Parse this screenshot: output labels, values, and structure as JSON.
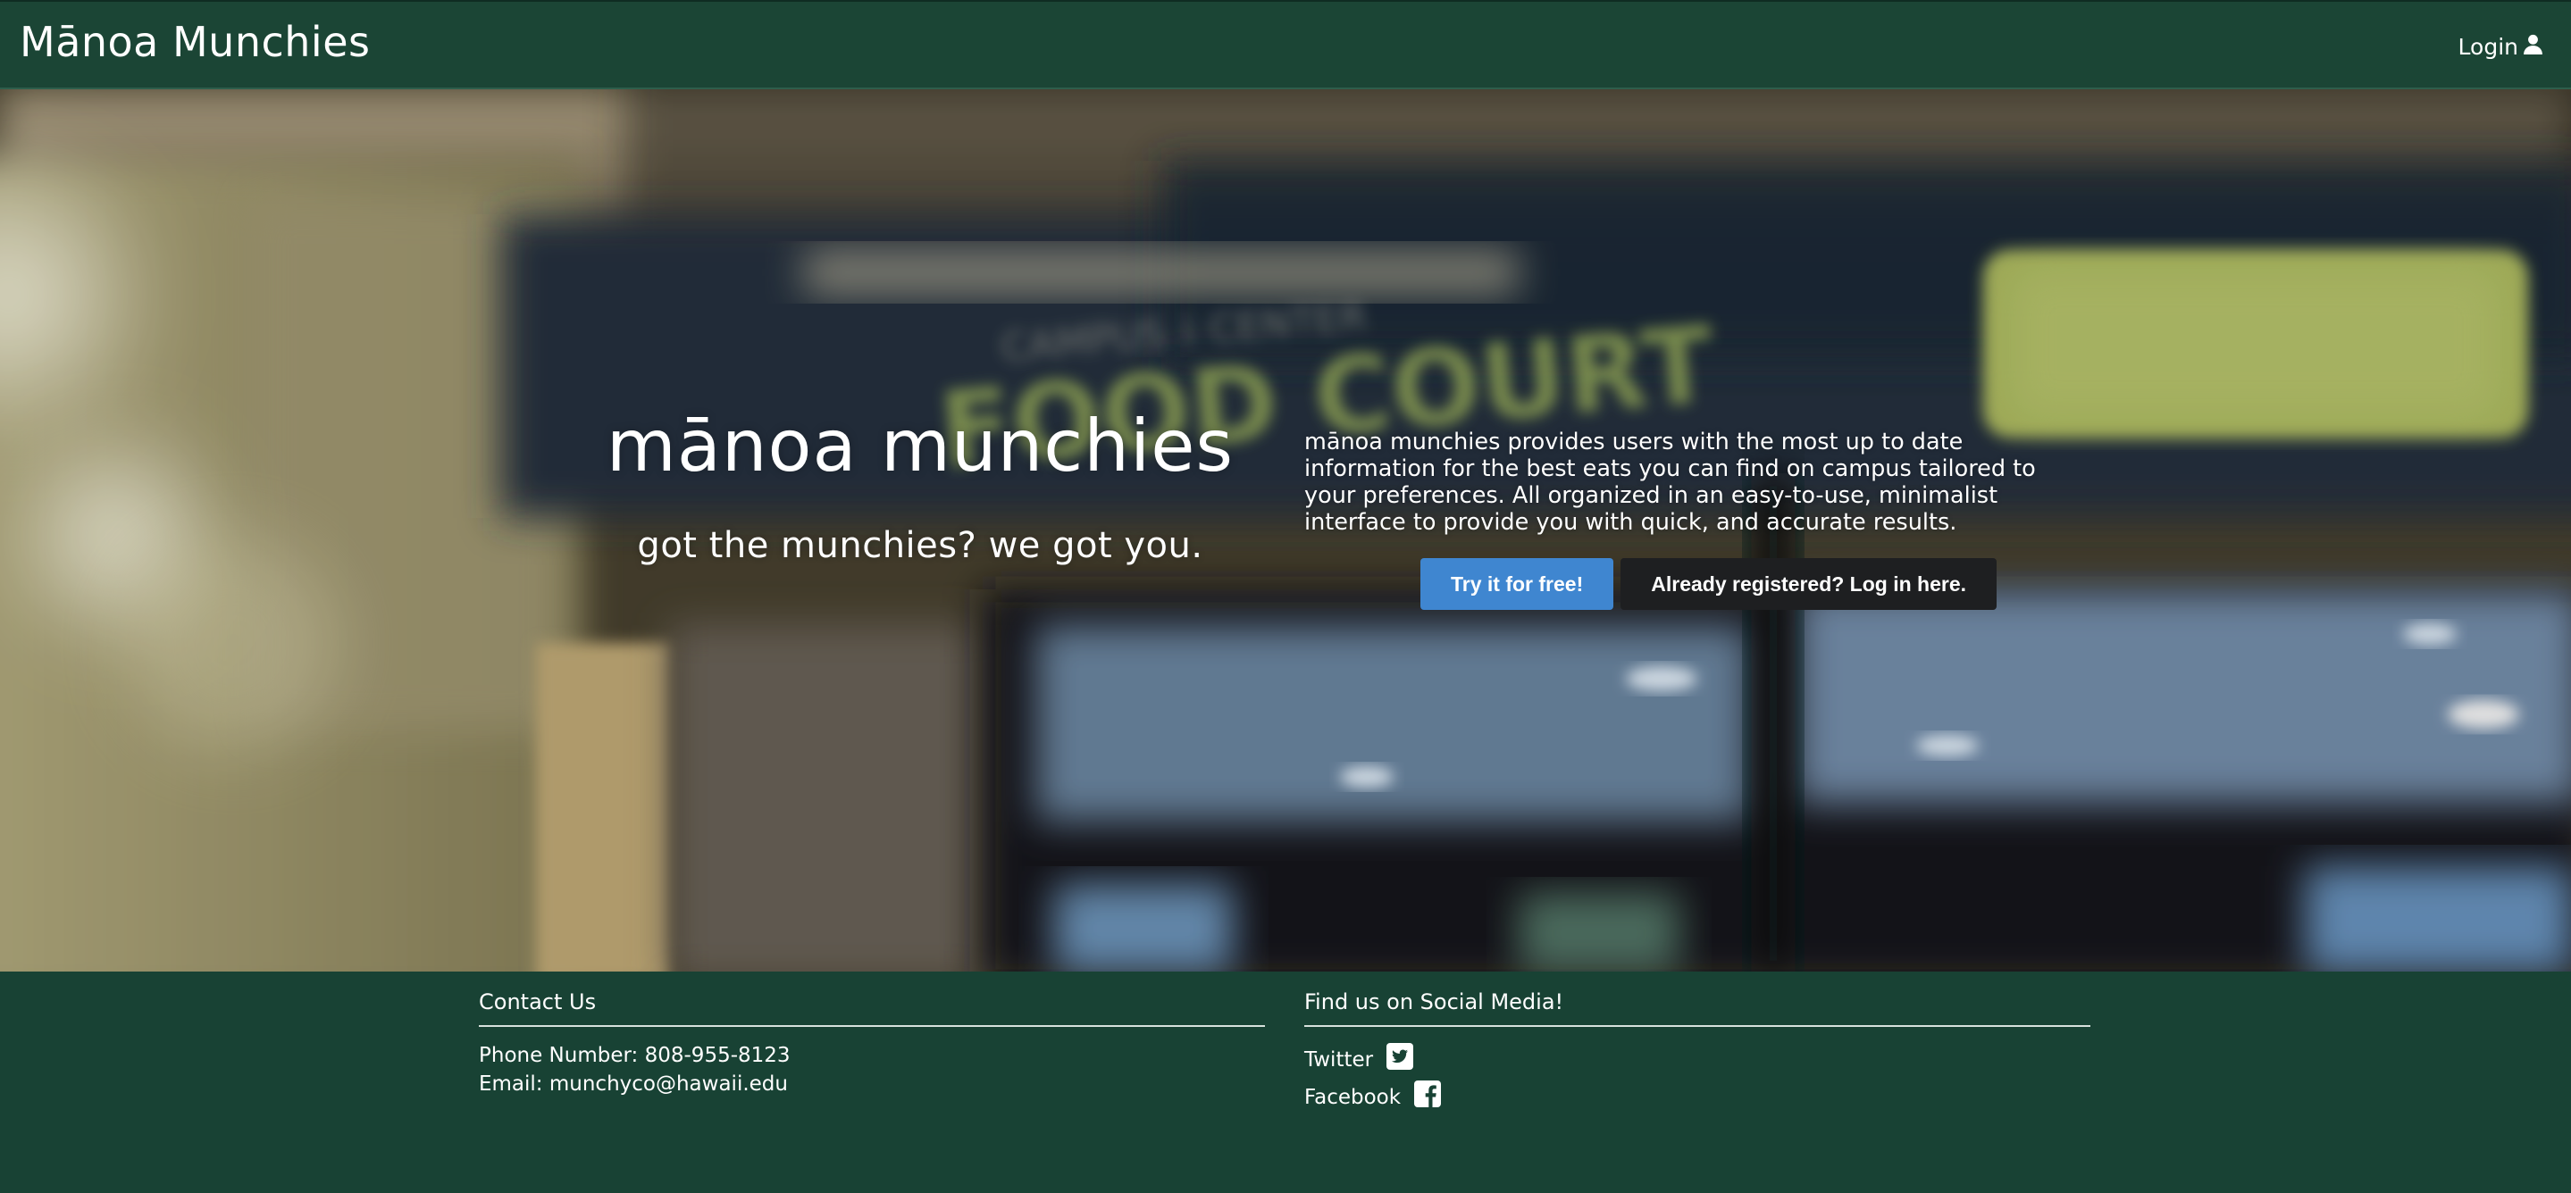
{
  "navbar": {
    "brand": "Mānoa Munchies",
    "login_label": "Login",
    "login_icon": "user-icon"
  },
  "hero": {
    "title": "mānoa munchies",
    "tagline": "got the munchies? we got you.",
    "description": "mānoa munchies provides users with the most up to date information for the best eats you can find on campus tailored to your preferences. All organized in an easy-to-use, minimalist interface to provide you with quick, and accurate results.",
    "primary_button": "Try it for free!",
    "secondary_button": "Already registered? Log in here.",
    "background_sign": "FOOD COURT",
    "colors": {
      "primary_button": "#3f86d0",
      "secondary_button": "#1e1f21"
    }
  },
  "footer": {
    "contact": {
      "heading": "Contact Us",
      "phone": "Phone Number: 808-955-8123",
      "email": "Email: munchyco@hawaii.edu"
    },
    "social": {
      "heading": "Find us on Social Media!",
      "twitter": "Twitter",
      "twitter_icon": "twitter-icon",
      "facebook": "Facebook",
      "facebook_icon": "facebook-icon"
    },
    "colors": {
      "background": "#184234"
    }
  }
}
